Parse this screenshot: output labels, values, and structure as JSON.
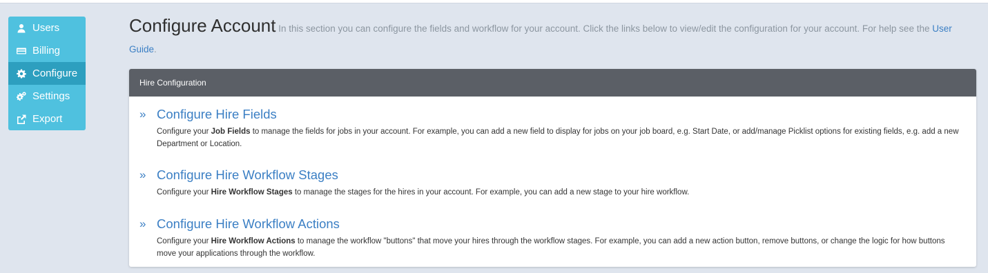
{
  "sidebar": {
    "items": [
      {
        "label": "Users",
        "icon": "user-icon"
      },
      {
        "label": "Billing",
        "icon": "credit-card-icon"
      },
      {
        "label": "Configure",
        "icon": "gear-icon",
        "active": true
      },
      {
        "label": "Settings",
        "icon": "gears-icon"
      },
      {
        "label": "Export",
        "icon": "export-icon"
      }
    ]
  },
  "header": {
    "title": "Configure Account",
    "description": " In this section you can configure the fields and workflow for your account. Click the links below to view/edit the configuration for your account. For help see the ",
    "guide_link": "User Guide",
    "period": "."
  },
  "panel": {
    "heading": "Hire Configuration",
    "sections": [
      {
        "title": "Configure Hire Fields",
        "desc_prefix": "Configure your ",
        "desc_bold": "Job Fields",
        "desc_suffix": " to manage the fields for jobs in your account. For example, you can add a new field to display for jobs on your job board, e.g. Start Date, or add/manage Picklist options for existing fields, e.g. add a new Department or Location."
      },
      {
        "title": "Configure Hire Workflow Stages",
        "desc_prefix": "Configure your ",
        "desc_bold": "Hire Workflow Stages",
        "desc_suffix": " to manage the stages for the hires in your account. For example, you can add a new stage to your hire workflow."
      },
      {
        "title": "Configure Hire Workflow Actions",
        "desc_prefix": "Configure your ",
        "desc_bold": "Hire Workflow Actions",
        "desc_suffix": " to manage the workflow \"buttons\" that move your hires through the workflow stages. For example, you can add a new action button, remove buttons, or change the logic for how buttons move your applications through the workflow."
      }
    ],
    "chevron": "»"
  },
  "colors": {
    "sidebar": "#4fc1df",
    "sidebar_active": "#2d9fbf",
    "link": "#3b7fc4",
    "panel_header": "#5b5f66",
    "background": "#dfe5ee"
  }
}
